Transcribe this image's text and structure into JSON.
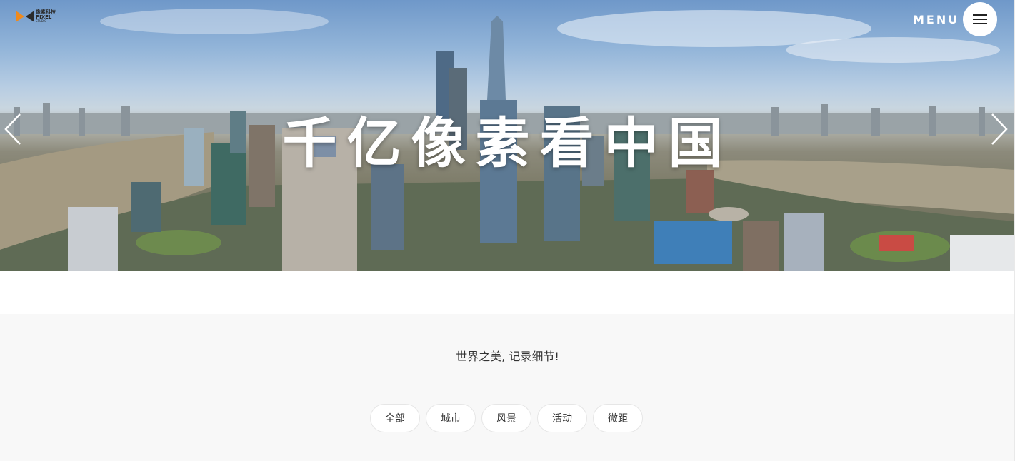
{
  "header": {
    "logo": {
      "line1": "像素科技",
      "line2": "PIXEL",
      "line3": "STUDIO",
      "colors": {
        "orange": "#f08a1c",
        "dark": "#2b2b2b"
      }
    },
    "menu_label": "MENU"
  },
  "hero": {
    "title": "千亿像素看中国",
    "prev_icon": "chevron-left-icon",
    "next_icon": "chevron-right-icon"
  },
  "main": {
    "tagline": "世界之美, 记录细节!",
    "filters": [
      {
        "label": "全部"
      },
      {
        "label": "城市"
      },
      {
        "label": "风景"
      },
      {
        "label": "活动"
      },
      {
        "label": "微距"
      }
    ]
  },
  "colors": {
    "content_bg": "#f8f8f8",
    "pill_bg": "#ffffff",
    "pill_border": "#e6e6e6",
    "text": "#333333"
  }
}
